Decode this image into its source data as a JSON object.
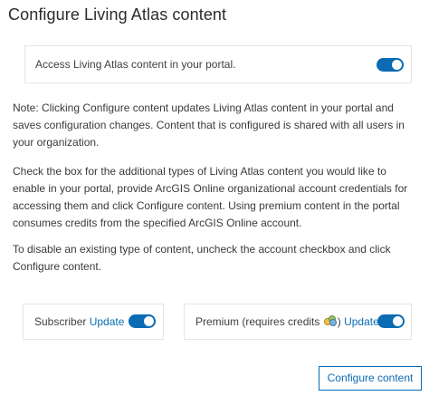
{
  "header": {
    "title": "Configure Living Atlas content"
  },
  "access": {
    "label": "Access Living Atlas content in your portal.",
    "enabled": true
  },
  "notes": {
    "note": "Note: Clicking Configure content updates Living Atlas content in your portal and saves configuration changes. Content that is configured is shared with all users in your organization.",
    "instructions": "Check the box for the additional types of Living Atlas content you would like to enable in your portal, provide ArcGIS Online organizational account credentials for accessing them and click Configure content. Using premium content in the portal consumes credits from the specified ArcGIS Online account.",
    "disable": "To disable an existing type of content, uncheck the account checkbox and click Configure content."
  },
  "subscriber": {
    "label": "Subscriber",
    "update_link": "Update",
    "enabled": true
  },
  "premium": {
    "label_prefix": "Premium (requires credits",
    "label_suffix": ")",
    "credits_icon": "credits-icon",
    "update_link": "Update",
    "enabled": true
  },
  "actions": {
    "configure_label": "Configure content"
  },
  "colors": {
    "accent": "#0b6bb3",
    "text": "#333333",
    "border": "#e6e6e6"
  }
}
